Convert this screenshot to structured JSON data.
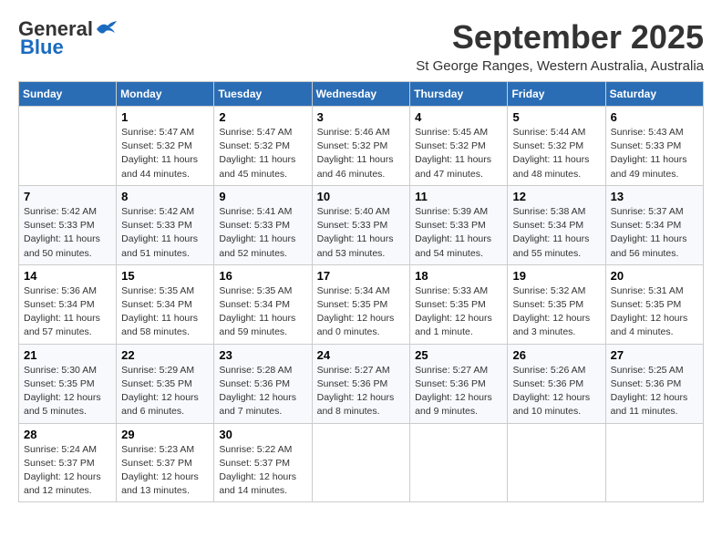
{
  "logo": {
    "general": "General",
    "blue": "Blue"
  },
  "title": "September 2025",
  "location": "St George Ranges, Western Australia, Australia",
  "days_of_week": [
    "Sunday",
    "Monday",
    "Tuesday",
    "Wednesday",
    "Thursday",
    "Friday",
    "Saturday"
  ],
  "weeks": [
    [
      {
        "day": "",
        "info": ""
      },
      {
        "day": "1",
        "info": "Sunrise: 5:47 AM\nSunset: 5:32 PM\nDaylight: 11 hours\nand 44 minutes."
      },
      {
        "day": "2",
        "info": "Sunrise: 5:47 AM\nSunset: 5:32 PM\nDaylight: 11 hours\nand 45 minutes."
      },
      {
        "day": "3",
        "info": "Sunrise: 5:46 AM\nSunset: 5:32 PM\nDaylight: 11 hours\nand 46 minutes."
      },
      {
        "day": "4",
        "info": "Sunrise: 5:45 AM\nSunset: 5:32 PM\nDaylight: 11 hours\nand 47 minutes."
      },
      {
        "day": "5",
        "info": "Sunrise: 5:44 AM\nSunset: 5:32 PM\nDaylight: 11 hours\nand 48 minutes."
      },
      {
        "day": "6",
        "info": "Sunrise: 5:43 AM\nSunset: 5:33 PM\nDaylight: 11 hours\nand 49 minutes."
      }
    ],
    [
      {
        "day": "7",
        "info": "Sunrise: 5:42 AM\nSunset: 5:33 PM\nDaylight: 11 hours\nand 50 minutes."
      },
      {
        "day": "8",
        "info": "Sunrise: 5:42 AM\nSunset: 5:33 PM\nDaylight: 11 hours\nand 51 minutes."
      },
      {
        "day": "9",
        "info": "Sunrise: 5:41 AM\nSunset: 5:33 PM\nDaylight: 11 hours\nand 52 minutes."
      },
      {
        "day": "10",
        "info": "Sunrise: 5:40 AM\nSunset: 5:33 PM\nDaylight: 11 hours\nand 53 minutes."
      },
      {
        "day": "11",
        "info": "Sunrise: 5:39 AM\nSunset: 5:33 PM\nDaylight: 11 hours\nand 54 minutes."
      },
      {
        "day": "12",
        "info": "Sunrise: 5:38 AM\nSunset: 5:34 PM\nDaylight: 11 hours\nand 55 minutes."
      },
      {
        "day": "13",
        "info": "Sunrise: 5:37 AM\nSunset: 5:34 PM\nDaylight: 11 hours\nand 56 minutes."
      }
    ],
    [
      {
        "day": "14",
        "info": "Sunrise: 5:36 AM\nSunset: 5:34 PM\nDaylight: 11 hours\nand 57 minutes."
      },
      {
        "day": "15",
        "info": "Sunrise: 5:35 AM\nSunset: 5:34 PM\nDaylight: 11 hours\nand 58 minutes."
      },
      {
        "day": "16",
        "info": "Sunrise: 5:35 AM\nSunset: 5:34 PM\nDaylight: 11 hours\nand 59 minutes."
      },
      {
        "day": "17",
        "info": "Sunrise: 5:34 AM\nSunset: 5:35 PM\nDaylight: 12 hours\nand 0 minutes."
      },
      {
        "day": "18",
        "info": "Sunrise: 5:33 AM\nSunset: 5:35 PM\nDaylight: 12 hours\nand 1 minute."
      },
      {
        "day": "19",
        "info": "Sunrise: 5:32 AM\nSunset: 5:35 PM\nDaylight: 12 hours\nand 3 minutes."
      },
      {
        "day": "20",
        "info": "Sunrise: 5:31 AM\nSunset: 5:35 PM\nDaylight: 12 hours\nand 4 minutes."
      }
    ],
    [
      {
        "day": "21",
        "info": "Sunrise: 5:30 AM\nSunset: 5:35 PM\nDaylight: 12 hours\nand 5 minutes."
      },
      {
        "day": "22",
        "info": "Sunrise: 5:29 AM\nSunset: 5:35 PM\nDaylight: 12 hours\nand 6 minutes."
      },
      {
        "day": "23",
        "info": "Sunrise: 5:28 AM\nSunset: 5:36 PM\nDaylight: 12 hours\nand 7 minutes."
      },
      {
        "day": "24",
        "info": "Sunrise: 5:27 AM\nSunset: 5:36 PM\nDaylight: 12 hours\nand 8 minutes."
      },
      {
        "day": "25",
        "info": "Sunrise: 5:27 AM\nSunset: 5:36 PM\nDaylight: 12 hours\nand 9 minutes."
      },
      {
        "day": "26",
        "info": "Sunrise: 5:26 AM\nSunset: 5:36 PM\nDaylight: 12 hours\nand 10 minutes."
      },
      {
        "day": "27",
        "info": "Sunrise: 5:25 AM\nSunset: 5:36 PM\nDaylight: 12 hours\nand 11 minutes."
      }
    ],
    [
      {
        "day": "28",
        "info": "Sunrise: 5:24 AM\nSunset: 5:37 PM\nDaylight: 12 hours\nand 12 minutes."
      },
      {
        "day": "29",
        "info": "Sunrise: 5:23 AM\nSunset: 5:37 PM\nDaylight: 12 hours\nand 13 minutes."
      },
      {
        "day": "30",
        "info": "Sunrise: 5:22 AM\nSunset: 5:37 PM\nDaylight: 12 hours\nand 14 minutes."
      },
      {
        "day": "",
        "info": ""
      },
      {
        "day": "",
        "info": ""
      },
      {
        "day": "",
        "info": ""
      },
      {
        "day": "",
        "info": ""
      }
    ]
  ]
}
